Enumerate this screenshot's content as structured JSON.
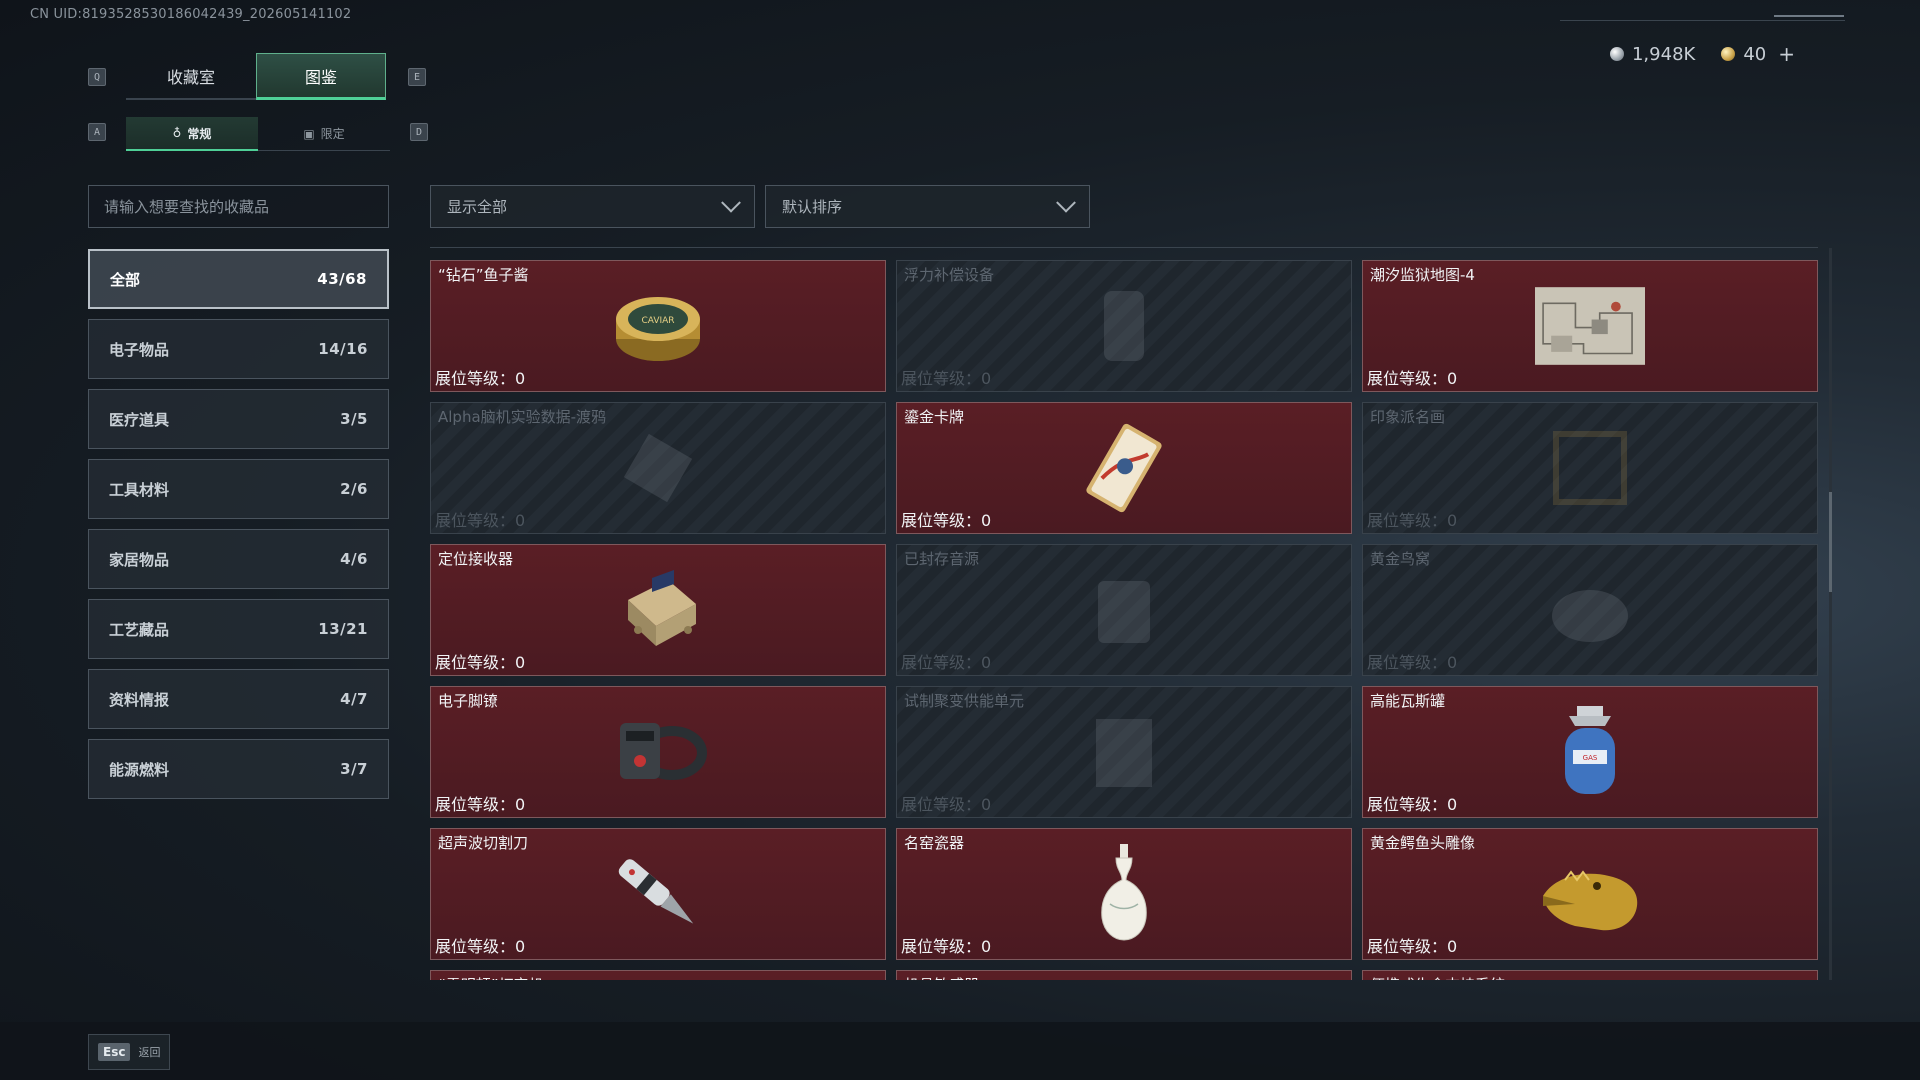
{
  "uid": "CN UID:8193528530186042439_202605141102",
  "currency": {
    "silver": "1,948K",
    "gold": "40",
    "add": "+"
  },
  "keys": {
    "q": "Q",
    "e": "E",
    "a": "A",
    "d": "D"
  },
  "tabs": [
    {
      "label": "收藏室"
    },
    {
      "label": "图鉴"
    }
  ],
  "subtabs": [
    {
      "label": "常规"
    },
    {
      "label": "限定"
    }
  ],
  "search": {
    "placeholder": "请输入想要查找的收藏品"
  },
  "filters": {
    "show": "显示全部",
    "sort": "默认排序"
  },
  "categories": [
    {
      "label": "全部",
      "count": "43/68"
    },
    {
      "label": "电子物品",
      "count": "14/16"
    },
    {
      "label": "医疗道具",
      "count": "3/5"
    },
    {
      "label": "工具材料",
      "count": "2/6"
    },
    {
      "label": "家居物品",
      "count": "4/6"
    },
    {
      "label": "工艺藏品",
      "count": "13/21"
    },
    {
      "label": "资料情报",
      "count": "4/7"
    },
    {
      "label": "能源燃料",
      "count": "3/7"
    }
  ],
  "level_label": "展位等级：0",
  "items": [
    {
      "name": "“钻石”鱼子酱",
      "owned": true,
      "icon": "caviar-tin-icon"
    },
    {
      "name": "浮力补偿设备",
      "owned": false,
      "icon": "buoyancy-device-icon"
    },
    {
      "name": "潮汐监狱地图-4",
      "owned": true,
      "icon": "prison-map-icon"
    },
    {
      "name": "Alpha脑机实验数据-渡鸦",
      "owned": false,
      "icon": "data-drive-icon"
    },
    {
      "name": "鎏金卡牌",
      "owned": true,
      "icon": "gilded-card-icon"
    },
    {
      "name": "印象派名画",
      "owned": false,
      "icon": "painting-icon"
    },
    {
      "name": "定位接收器",
      "owned": true,
      "icon": "gps-receiver-icon"
    },
    {
      "name": "已封存音源",
      "owned": false,
      "icon": "sealed-audio-icon"
    },
    {
      "name": "黄金鸟窝",
      "owned": false,
      "icon": "golden-nest-icon"
    },
    {
      "name": "电子脚镣",
      "owned": true,
      "icon": "ankle-monitor-icon"
    },
    {
      "name": "试制聚变供能单元",
      "owned": false,
      "icon": "fusion-unit-icon"
    },
    {
      "name": "高能瓦斯罐",
      "owned": true,
      "icon": "gas-canister-icon"
    },
    {
      "name": "超声波切割刀",
      "owned": true,
      "icon": "ultrasonic-cutter-icon"
    },
    {
      "name": "名窑瓷器",
      "owned": true,
      "icon": "porcelain-vase-icon"
    },
    {
      "name": "黄金鳄鱼头雕像",
      "owned": true,
      "icon": "golden-crocodile-icon"
    },
    {
      "name": "“雷明顿”打字机",
      "owned": true,
      "icon": "typewriter-icon"
    },
    {
      "name": "机具敏感器",
      "owned": true,
      "icon": "sensor-icon"
    },
    {
      "name": "便携式生命支持系统",
      "owned": true,
      "icon": "life-support-icon"
    }
  ],
  "footer": {
    "key": "Esc",
    "label": "返回"
  }
}
